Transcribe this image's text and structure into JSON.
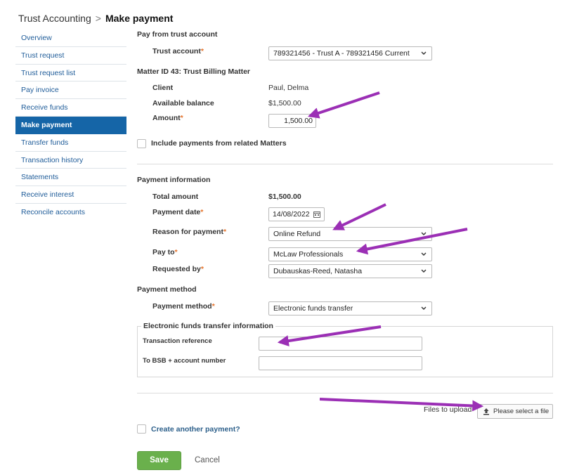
{
  "breadcrumb": {
    "parent": "Trust Accounting",
    "separator": ">",
    "current": "Make payment"
  },
  "sidebar": {
    "items": [
      {
        "label": "Overview"
      },
      {
        "label": "Trust request"
      },
      {
        "label": "Trust request list"
      },
      {
        "label": "Pay invoice"
      },
      {
        "label": "Receive funds"
      },
      {
        "label": "Make payment",
        "active": true
      },
      {
        "label": "Transfer funds"
      },
      {
        "label": "Transaction history"
      },
      {
        "label": "Statements"
      },
      {
        "label": "Receive interest"
      },
      {
        "label": "Reconcile accounts"
      }
    ]
  },
  "required_mark": "*",
  "pay_from": {
    "heading": "Pay from trust account",
    "trust_account_label": "Trust account",
    "trust_account_value": "789321456 - Trust A - 789321456 Current"
  },
  "matter": {
    "heading": "Matter ID 43: Trust Billing Matter",
    "client_label": "Client",
    "client_value": "Paul, Delma",
    "balance_label": "Available balance",
    "balance_value": "$1,500.00",
    "amount_label": "Amount",
    "amount_value": "1,500.00",
    "include_related_label": "Include payments from related Matters"
  },
  "payment_info": {
    "heading": "Payment information",
    "total_label": "Total amount",
    "total_value": "$1,500.00",
    "date_label": "Payment date",
    "date_value": "14/08/2022",
    "reason_label": "Reason for payment",
    "reason_value": "Online Refund",
    "pay_to_label": "Pay to",
    "pay_to_value": "McLaw Professionals",
    "requested_by_label": "Requested by",
    "requested_by_value": "Dubauskas-Reed, Natasha"
  },
  "payment_method": {
    "heading": "Payment method",
    "method_label": "Payment method",
    "method_value": "Electronic funds transfer"
  },
  "eft": {
    "legend": "Electronic funds transfer information",
    "transaction_reference_label": "Transaction reference",
    "transaction_reference_value": "",
    "bsb_label": "To BSB + account number",
    "bsb_value": ""
  },
  "files": {
    "label": "Files to upload",
    "button_label": "Please select a file"
  },
  "footer": {
    "create_another_label": "Create another payment?",
    "save_label": "Save",
    "cancel_label": "Cancel"
  },
  "colors": {
    "accent": "#1565a7",
    "link": "#1f5c99",
    "save_button": "#6ab04c",
    "required": "#e6732b",
    "annotation_arrow": "#9b2fb5"
  },
  "icons": [
    "chevron-right-icon",
    "chevron-down-icon",
    "calendar-icon",
    "upload-icon",
    "annotation-arrow"
  ]
}
